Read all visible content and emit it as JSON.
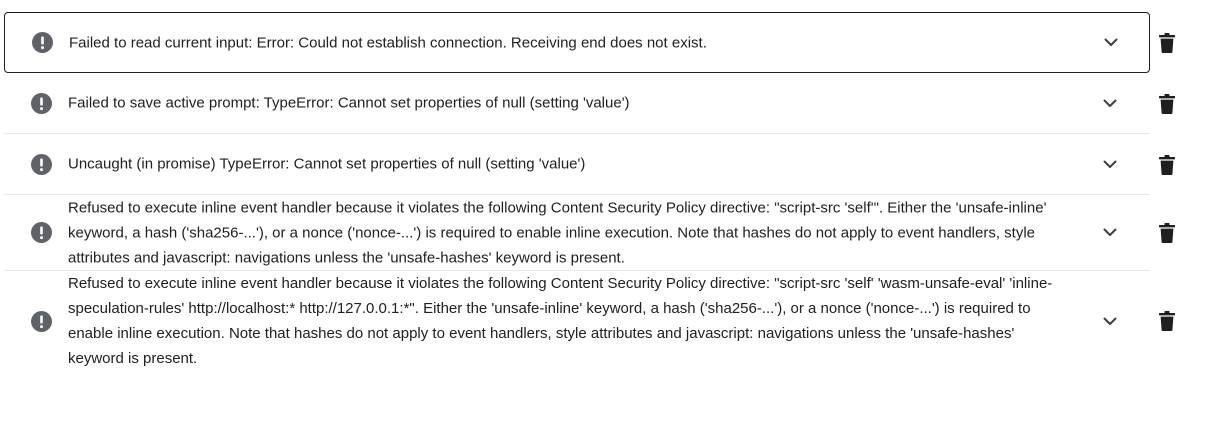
{
  "errors": [
    {
      "message": "Failed to read current input: Error: Could not establish connection. Receiving end does not exist.",
      "selected": true
    },
    {
      "message": "Failed to save active prompt: TypeError: Cannot set properties of null (setting 'value')",
      "selected": false
    },
    {
      "message": "Uncaught (in promise) TypeError: Cannot set properties of null (setting 'value')",
      "selected": false
    },
    {
      "message": "Refused to execute inline event handler because it violates the following Content Security Policy directive: \"script-src 'self'\". Either the 'unsafe-inline' keyword, a hash ('sha256-...'), or a nonce ('nonce-...') is required to enable inline execution. Note that hashes do not apply to event handlers, style attributes and javascript: navigations unless the 'unsafe-hashes' keyword is present.",
      "selected": false
    },
    {
      "message": "Refused to execute inline event handler because it violates the following Content Security Policy directive: \"script-src 'self' 'wasm-unsafe-eval' 'inline-speculation-rules' http://localhost:* http://127.0.0.1:*\". Either the 'unsafe-inline' keyword, a hash ('sha256-...'), or a nonce ('nonce-...') is required to enable inline execution. Note that hashes do not apply to event handlers, style attributes and javascript: navigations unless the 'unsafe-hashes' keyword is present.",
      "selected": false
    }
  ],
  "icons": {
    "error": "error-icon",
    "expand": "chevron-down-icon",
    "delete": "trash-icon"
  },
  "colors": {
    "icon": "#5f6368",
    "text": "#202124",
    "selected_border": "#1f1f1f",
    "divider": "#e8e8e8"
  }
}
